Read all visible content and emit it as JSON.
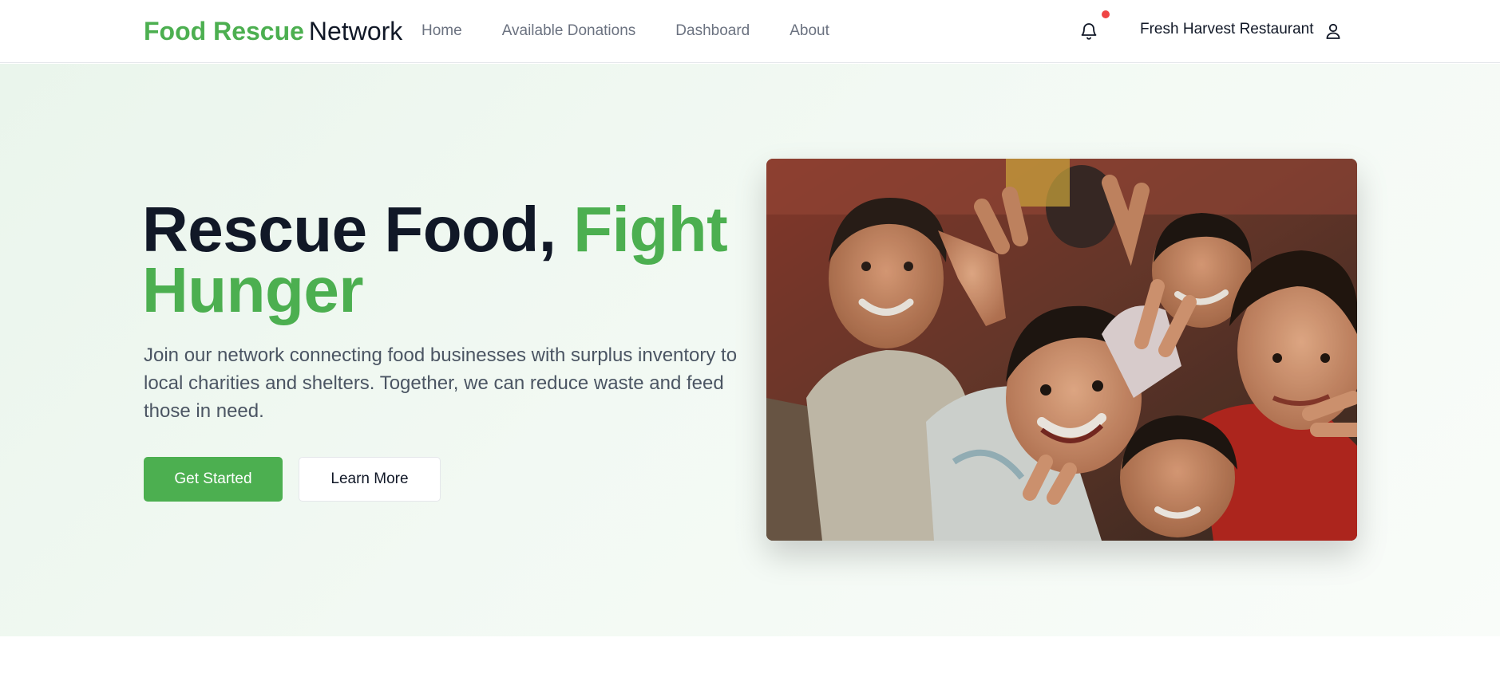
{
  "brand": {
    "name_part1": "Food Rescue",
    "name_part2": "Network",
    "accent_color": "#4caf50"
  },
  "nav": {
    "items": [
      {
        "label": "Home"
      },
      {
        "label": "Available Donations"
      },
      {
        "label": "Dashboard"
      },
      {
        "label": "About"
      }
    ]
  },
  "header_right": {
    "notification_icon": "bell-icon",
    "has_unread": true,
    "user_name": "Fresh Harvest Restaurant",
    "user_icon": "user-icon"
  },
  "hero": {
    "title_part1": "Rescue Food, ",
    "title_part2": "Fight Hunger",
    "subtitle": "Join our network connecting food businesses with surplus inventory to local charities and shelters. Together, we can reduce waste and feed those in need.",
    "primary_button": "Get Started",
    "secondary_button": "Learn More",
    "image_subject": "group of smiling children making peace signs"
  }
}
